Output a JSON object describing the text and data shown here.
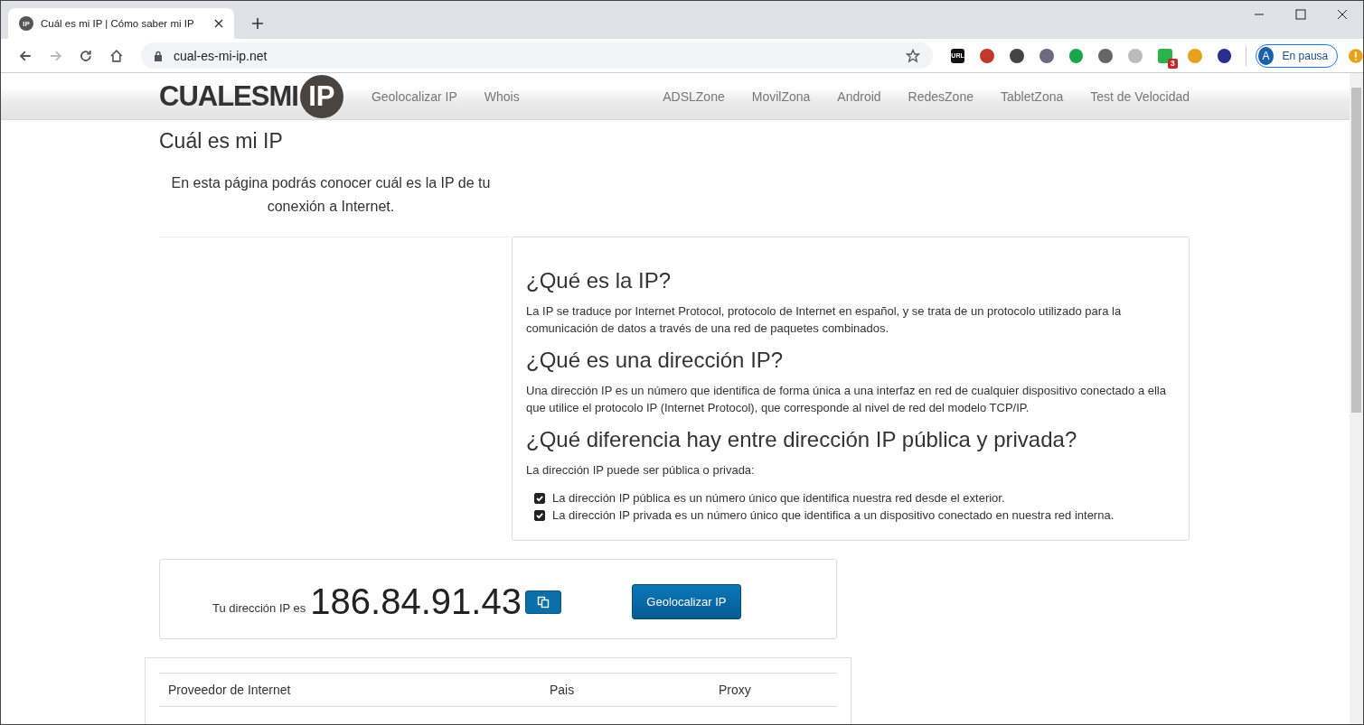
{
  "browser": {
    "tab": {
      "title": "Cuál es mi IP | Cómo saber mi IP",
      "favicon_text": "IP"
    },
    "address": "cual-es-mi-ip.net",
    "extensions": [
      {
        "kind": "url",
        "label": "URL",
        "color": "#111111"
      },
      {
        "kind": "plain",
        "color": "#c0392b"
      },
      {
        "kind": "plain",
        "color": "#444444"
      },
      {
        "kind": "plain",
        "color": "#6b6a80"
      },
      {
        "kind": "plain",
        "color": "#1aa64a"
      },
      {
        "kind": "plain",
        "color": "#666666"
      },
      {
        "kind": "plain",
        "color": "#bbbbbb"
      },
      {
        "kind": "badge",
        "badge": "3",
        "color": "#2bb24c"
      },
      {
        "kind": "plain",
        "color": "#e8a11a"
      },
      {
        "kind": "plain",
        "color": "#2a2f8f"
      }
    ],
    "profile": {
      "initial": "A",
      "label": "En pausa"
    }
  },
  "site": {
    "logo": {
      "text": "CUALESMI",
      "circle_text": "IP"
    },
    "nav_left": [
      "Geolocalizar IP",
      "Whois"
    ],
    "nav_right": [
      "ADSLZone",
      "MovilZona",
      "Android",
      "RedesZone",
      "TabletZona",
      "Test de Velocidad"
    ]
  },
  "page_title": "Cuál es mi IP",
  "intro": "En esta página podrás conocer cuál es la IP de tu conexión a Internet.",
  "info": {
    "sections": [
      {
        "heading": "¿Qué es la IP?",
        "text": "La IP se traduce por Internet Protocol, protocolo de Internet en español, y se trata de un protocolo utilizado para la comunicación de datos a través de una red de paquetes combinados."
      },
      {
        "heading": "¿Qué es una dirección IP?",
        "text": "Una dirección IP es un número que identifica de forma única a una interfaz en red de cualquier dispositivo conectado a ella que utilice el protocolo IP (Internet Protocol), que corresponde al nivel de red del modelo TCP/IP."
      },
      {
        "heading": "¿Qué diferencia hay entre dirección IP pública y privada?",
        "text": "La dirección IP puede ser pública o privada:"
      }
    ],
    "checklist": [
      {
        "text": "La dirección IP pública es un número único que identifica nuestra red desde el exterior.",
        "checked": true
      },
      {
        "text": "La dirección IP privada es un número único que identifica a un dispositivo conectado en nuestra red interna.",
        "checked": true
      }
    ]
  },
  "ip_box": {
    "label": "Tu dirección IP es",
    "ip": "186.84.91.43",
    "button": "Geolocalizar IP"
  },
  "table": {
    "columns": [
      "Proveedor de Internet",
      "Pais",
      "Proxy"
    ]
  }
}
